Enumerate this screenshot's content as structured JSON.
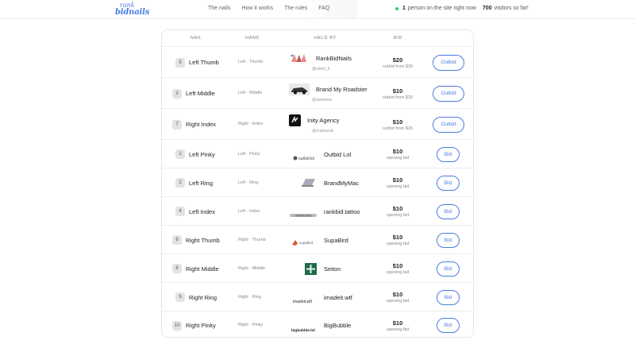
{
  "header": {
    "logo_line1": "rank",
    "logo_line2": "bidnails",
    "nav": [
      "The nails",
      "How it works",
      "The rules",
      "FAQ"
    ],
    "online_count": "1",
    "online_text": "person on the site right now",
    "visitors_count": "700",
    "visitors_text": "visitors so far!"
  },
  "table": {
    "columns": [
      "NAIL",
      "HAND",
      "HELD BY",
      "BID"
    ],
    "rows": [
      {
        "num": "5",
        "nail": "Left Thumb",
        "hand": "Left · Thumb",
        "holder": "RankBidNails",
        "handle": "@alexi_ll",
        "price": "$20",
        "sub": "outbid from $30",
        "action": "Outbid",
        "logo": "nails-logo"
      },
      {
        "num": "3",
        "nail": "Left Middle",
        "hand": "Left · Middle",
        "holder": "Brand My Roadster",
        "handle": "@iammeu",
        "price": "$10",
        "sub": "outbid from $20",
        "action": "Outbid",
        "logo": "car-logo"
      },
      {
        "num": "7",
        "nail": "Right Index",
        "hand": "Right · Index",
        "holder": "Inity Agency",
        "handle": "@ivabuzuk",
        "price": "$10",
        "sub": "outbid from $20",
        "action": "Outbid",
        "logo": "inity-logo"
      },
      {
        "num": "1",
        "nail": "Left Pinky",
        "hand": "Left · Pinky",
        "holder": "Outbid Lol",
        "handle": "",
        "price": "$10",
        "sub": "opening bid",
        "action": "Bid",
        "logo": "outbid-logo",
        "logo_text": "outbid.lol"
      },
      {
        "num": "2",
        "nail": "Left Ring",
        "hand": "Left · Ring",
        "holder": "BrandMyMac",
        "handle": "",
        "price": "$10",
        "sub": "opening bid",
        "action": "Bid",
        "logo": "mac-logo"
      },
      {
        "num": "4",
        "nail": "Left Index",
        "hand": "Left · Index",
        "holder": "rankbid.tattoo",
        "handle": "",
        "price": "$10",
        "sub": "opening bid",
        "action": "Bid",
        "logo": "tattoo-logo",
        "logo_text": "rankbid.tattoo"
      },
      {
        "num": "6",
        "nail": "Right Thumb",
        "hand": "Right · Thumb",
        "holder": "SupaBird",
        "handle": "",
        "price": "$10",
        "sub": "opening bid",
        "action": "Bid",
        "logo": "supabird-logo",
        "logo_text": "supabird"
      },
      {
        "num": "8",
        "nail": "Right Middle",
        "hand": "Right · Middle",
        "holder": "Seiton",
        "handle": "",
        "price": "$10",
        "sub": "opening bid",
        "action": "Bid",
        "logo": "seiton-logo"
      },
      {
        "num": "9",
        "nail": "Right Ring",
        "hand": "Right · Ring",
        "holder": "imadeit.wtf",
        "handle": "",
        "price": "$10",
        "sub": "opening bid",
        "action": "Bid",
        "logo": "imadeit-logo",
        "logo_text": "imadeit.wtf"
      },
      {
        "num": "10",
        "nail": "Right Pinky",
        "hand": "Right · Pinky",
        "holder": "BigBubble",
        "handle": "",
        "price": "$10",
        "sub": "opening bid",
        "action": "Bid",
        "logo": "bigbubble-logo",
        "logo_text": "bigbubble.lol"
      }
    ]
  },
  "colors": {
    "accent": "#4a7be0",
    "online_dot": "#2ecc71",
    "badge_bg": "#e3e3e3"
  }
}
